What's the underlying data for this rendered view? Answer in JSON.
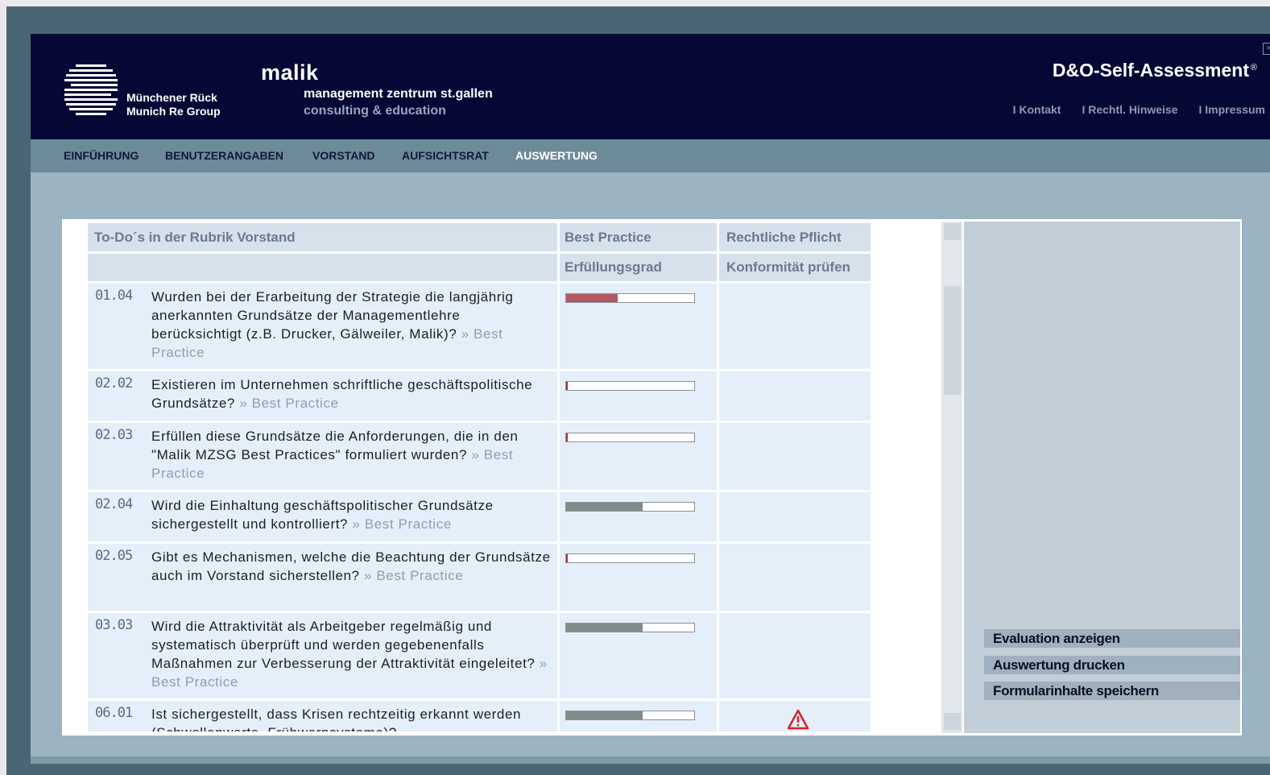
{
  "header": {
    "brand_line1": "Münchener Rück",
    "brand_line2": "Munich Re Group",
    "malik": "malik",
    "mz_line1": "management zentrum st.gallen",
    "mz_line2": "consulting & education",
    "app_title": "D&O-Self-Assessment",
    "registered": "®",
    "close": "×",
    "links": [
      "I Kontakt",
      "I Rechtl. Hinweise",
      "I Impressum"
    ]
  },
  "nav": {
    "items": [
      "EINFÜHRUNG",
      "BENUTZERANGABEN",
      "VORSTAND",
      "AUFSICHTSRAT",
      "AUSWERTUNG"
    ],
    "active": "AUSWERTUNG"
  },
  "table": {
    "col1_header": "To-Do´s in der Rubrik Vorstand",
    "col2_header": "Best Practice",
    "col3_header": "Rechtliche Pflicht",
    "col2_sub": "Erfüllungsgrad",
    "col3_sub": "Konformität prüfen",
    "link_text": "» Best Practice",
    "rows": [
      {
        "num": "01.04",
        "text": "Wurden bei der Erarbeitung der Strategie die langjährig anerkannten Grundsätze der Managementlehre berücksichtigt (z.B. Drucker, Gälweiler, Malik)?",
        "progress": 0.4,
        "bar_color": "#b05a62",
        "warning": false
      },
      {
        "num": "02.02",
        "text": "Existieren im Unternehmen schriftliche geschäftspolitische Grundsätze?",
        "progress": 0.01,
        "bar_color": "#b03040",
        "warning": false
      },
      {
        "num": "02.03",
        "text": "Erfüllen diese Grundsätze die Anforderungen, die in den \"Malik MZSG Best Practices\" formuliert wurden?",
        "progress": 0.01,
        "bar_color": "#b03040",
        "warning": false
      },
      {
        "num": "02.04",
        "text": "Wird die Einhaltung geschäftspolitischer Grundsätze sichergestellt und kontrolliert?",
        "progress": 0.6,
        "bar_color": "#7f8c8a",
        "warning": false
      },
      {
        "num": "02.05",
        "text": "Gibt es Mechanismen, welche die Beachtung der Grundsätze auch im Vorstand sicherstellen?",
        "progress": 0.01,
        "bar_color": "#b03040",
        "warning": false
      },
      {
        "num": "03.03",
        "text": "Wird die Attraktivität als Arbeitgeber regelmäßig und systematisch überprüft und werden gegebenenfalls Maßnahmen zur Verbesserung der Attraktivität eingeleitet?",
        "progress": 0.6,
        "bar_color": "#7f8c8a",
        "warning": false
      },
      {
        "num": "06.01",
        "text": "Ist sichergestellt, dass Krisen rechtzeitig erkannt werden (Schwellenwerte, Frühwarnsysteme)?",
        "progress": 0.6,
        "bar_color": "#7f8c8a",
        "warning": true
      }
    ]
  },
  "sidebar": {
    "buttons": [
      "Evaluation anzeigen",
      "Auswertung drucken",
      "Formularinhalte speichern"
    ]
  },
  "colors": {
    "header_bg": "#050835",
    "nav_bg": "#6d8a99",
    "warning": "#d8202a"
  }
}
